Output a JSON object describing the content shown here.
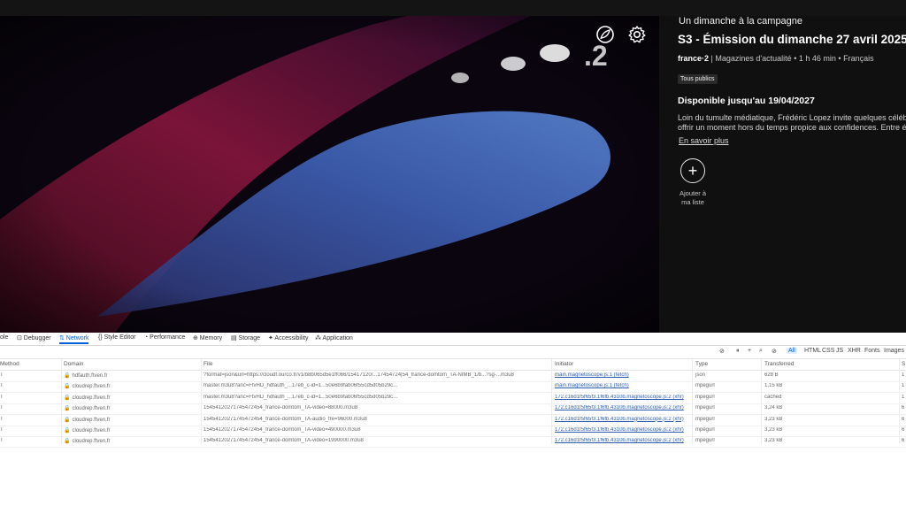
{
  "player": {
    "channel_logo_text": ".2",
    "eco_icon": "leaf-icon",
    "settings_icon": "gear-icon"
  },
  "info": {
    "program": "Un dimanche à la campagne",
    "title": "S3 - Émission du dimanche 27 avril 2025",
    "channel": "france·2",
    "meta_sep": "|",
    "genre": "Magazines d'actualité",
    "dot1": "•",
    "duration": "1 h 46 min",
    "dot2": "•",
    "language": "Français",
    "badge": "Tous publics",
    "availability": "Disponible jusqu'au 19/04/2027",
    "description": "Loin du tumulte médiatique, Frédéric Lopez invite quelques célébrités\noffrir un moment hors du temps propice aux confidences. Entre émoti",
    "more_link": "En savoir plus",
    "add_symbol": "+",
    "add_label": "Ajouter à\nma liste"
  },
  "devtools": {
    "tabs": [
      {
        "label": "ole"
      },
      {
        "label": "⊡ Debugger"
      },
      {
        "label": "⇅ Network"
      },
      {
        "label": "{} Style Editor"
      },
      {
        "label": "◔ Performance"
      },
      {
        "label": "⊕ Memory"
      },
      {
        "label": "▤ Storage"
      },
      {
        "label": "✦ Accessibility"
      },
      {
        "label": "⁂ Application"
      }
    ],
    "toolbar": {
      "trash": "⊘",
      "pause": "⏸",
      "plus": "+",
      "search": "⌕",
      "block": "⊘",
      "filters": [
        "All",
        "HTML",
        "CSS",
        "JS",
        "XHR",
        "Fonts",
        "Images"
      ]
    },
    "columns": [
      "Method",
      "Domain",
      "File",
      "Initiator",
      "Type",
      "Transferred",
      "S"
    ],
    "rows": [
      {
        "method": "T",
        "domain": "hdfauth.ftven.fr",
        "file": "?format=json&url=https://cloudf.ourco.fr/v1/b8b065d5e1ff066/15417120/...17454724|54_france-domtom_TA-NIMB_1/b...?sg-...m3u8",
        "initiator": "main.magnetoscope.js:1 (fetch)",
        "type": "json",
        "transferred": "628 B",
        "size": "1"
      },
      {
        "method": "T",
        "domain": "cloudrep.ftven.fr",
        "file": "master.m3u8?anc=FtvHD_hdfauth_...17eb_c-id=1...50e6b9fab06f55cd5d05b29c...",
        "initiator": "main.magnetoscope.js:1 (fetch)",
        "type": "mpegurl",
        "transferred": "1,15 kB",
        "size": "1"
      },
      {
        "method": "T",
        "domain": "cloudrep.ftven.fr",
        "file": "master.m3u8?anc=FtvHD_hdfauth_...17eb_c-id=1...50e6b9fab06f55cd5d05b29c...",
        "initiator": "172.c16d1f5f65f3.1f6fb.4310b.magnetoscope.js:2 (xhr)",
        "type": "mpegurl",
        "transferred": "cached",
        "size": "1"
      },
      {
        "method": "T",
        "domain": "cloudrep.ftven.fr",
        "file": "15454120271745472454_france-domtom_TA-video=88000.m3u8",
        "initiator": "172.c16d1f5f65f3.1f6fb.4310b.magnetoscope.js:2 (xhr)",
        "type": "mpegurl",
        "transferred": "3,24 kB",
        "size": "6"
      },
      {
        "method": "T",
        "domain": "cloudrep.ftven.fr",
        "file": "15454120271745472454_france-domtom_TA-audio_fre=96000.m3u8",
        "initiator": "172.c16d1f5f65f3.1f6fb.4310b.magnetoscope.js:2 (xhr)",
        "type": "mpegurl",
        "transferred": "3,23 kB",
        "size": "6"
      },
      {
        "method": "T",
        "domain": "cloudrep.ftven.fr",
        "file": "15454120271745472454_france-domtom_TA-video=490000.m3u8",
        "initiator": "172.c16d1f5f65f3.1f6fb.4310b.magnetoscope.js:2 (xhr)",
        "type": "mpegurl",
        "transferred": "3,23 kB",
        "size": "6"
      },
      {
        "method": "T",
        "domain": "cloudrep.ftven.fr",
        "file": "15454120271745472454_france-domtom_TA-video=1990000.m3u8",
        "initiator": "172.c16d1f5f65f3.1f6fb.4310b.magnetoscope.js:2 (xhr)",
        "type": "mpegurl",
        "transferred": "3,23 kB",
        "size": "6"
      }
    ]
  },
  "colors": {
    "accent": "#0060df",
    "panel_bg": "#101010"
  }
}
